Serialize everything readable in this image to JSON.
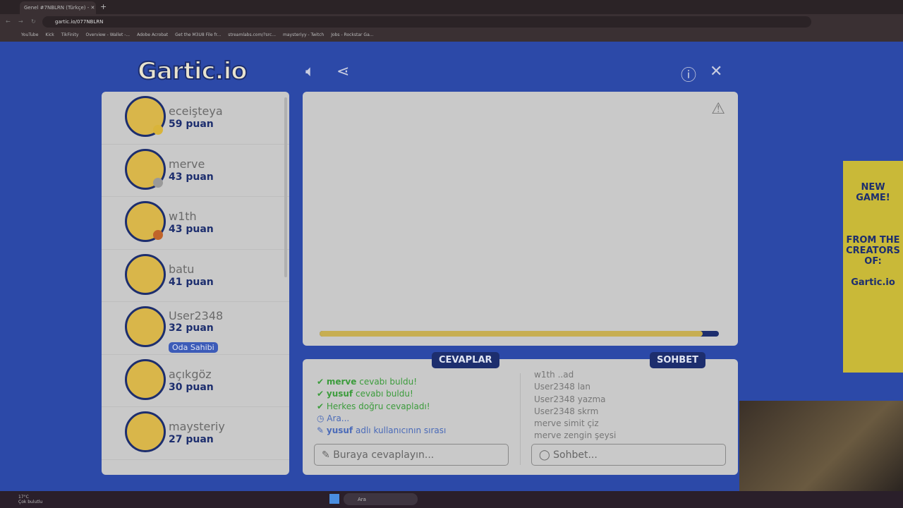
{
  "browser": {
    "tab_title": "Genel #7NBLRN (Türkçe) -",
    "url": "gartic.io/077NBLRN",
    "bookmarks": [
      "YouTube",
      "Kick",
      "TikFinity",
      "Overview - Wallet -...",
      "Adobe Acrobat",
      "Get the M3U8 File fr...",
      "streamlabs.com/?src...",
      "maysteriyy - Twitch",
      "Jobs - Rockstar Ga..."
    ]
  },
  "app": {
    "logo": "Gartic.io"
  },
  "players": [
    {
      "name": "eceişteya",
      "score": "59 puan",
      "dot": "#d9b43a"
    },
    {
      "name": "merve",
      "score": "43 puan",
      "dot": "#9a9a9a"
    },
    {
      "name": "w1th",
      "score": "43 puan",
      "dot": "#c0642a"
    },
    {
      "name": "batu",
      "score": "41 puan",
      "dot": ""
    },
    {
      "name": "User2348",
      "score": "32 puan",
      "dot": "",
      "badge": "Oda Sahibi"
    },
    {
      "name": "açıkgöz",
      "score": "30 puan",
      "dot": ""
    },
    {
      "name": "maysteriy",
      "score": "27 puan",
      "dot": ""
    }
  ],
  "timer": {
    "progress": 0.96
  },
  "answers": {
    "label": "CEVAPLAR",
    "items": [
      {
        "user": "merve",
        "text": "cevabı buldu!"
      },
      {
        "user": "yusuf",
        "text": "cevabı buldu!"
      },
      {
        "user": "",
        "text": "Herkes doğru cevapladı!"
      },
      {
        "user": "",
        "text": "Ara..."
      },
      {
        "user": "yusuf",
        "text": "adlı kullanıcının sırası"
      }
    ],
    "placeholder": "Buraya cevaplayın..."
  },
  "chat": {
    "label": "SOHBET",
    "items": [
      {
        "user": "w1th",
        "text": "..ad"
      },
      {
        "user": "User2348",
        "text": "lan"
      },
      {
        "user": "User2348",
        "text": "yazma"
      },
      {
        "user": "User2348",
        "text": "skrm"
      },
      {
        "user": "merve",
        "text": "simit çiz"
      },
      {
        "user": "merve",
        "text": "zengin şeysi"
      }
    ],
    "placeholder": "Sohbet..."
  },
  "ad": {
    "line1": "NEW GAME!",
    "line2": "FROM THE CREATORS OF:",
    "line3": "Gartic.io"
  },
  "taskbar": {
    "temp": "17°C",
    "weather": "Çok bulutlu",
    "search": "Ara"
  }
}
